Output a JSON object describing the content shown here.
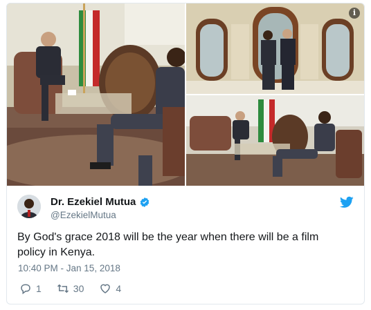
{
  "tweet": {
    "author_name": "Dr. Ezekiel Mutua",
    "handle": "@EzekielMutua",
    "text": "By God's grace 2018 will be the year when there will be a film policy in Kenya.",
    "timestamp": "10:40 PM - Jan 15, 2018",
    "replies": "1",
    "retweets": "30",
    "likes": "4",
    "info_label": "i"
  },
  "icons": {
    "verified": "verified-badge-icon",
    "bird": "twitter-bird-icon",
    "reply": "reply-icon",
    "retweet": "retweet-icon",
    "like": "heart-icon",
    "info": "info-icon"
  },
  "colors": {
    "brand": "#1da1f2",
    "text": "#14171a",
    "muted": "#657786",
    "border": "#e1e8ed"
  }
}
